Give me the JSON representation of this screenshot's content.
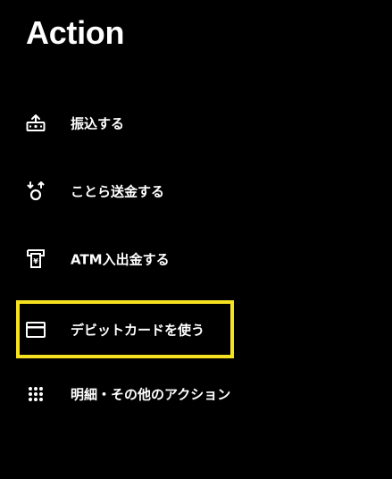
{
  "header": {
    "title": "Action"
  },
  "colors": {
    "background": "#000000",
    "text": "#ffffff",
    "highlight_border": "#f5e11f"
  },
  "menu": {
    "items": [
      {
        "label": "振込する",
        "icon": "bank-transfer-icon"
      },
      {
        "label": "ことら送金する",
        "icon": "kotora-send-icon"
      },
      {
        "label": "ATM入出金する",
        "icon": "atm-icon"
      },
      {
        "label": "デビットカードを使う",
        "icon": "credit-card-icon",
        "highlighted": true
      },
      {
        "label": "明細・その他のアクション",
        "icon": "grid-dots-icon"
      }
    ]
  }
}
